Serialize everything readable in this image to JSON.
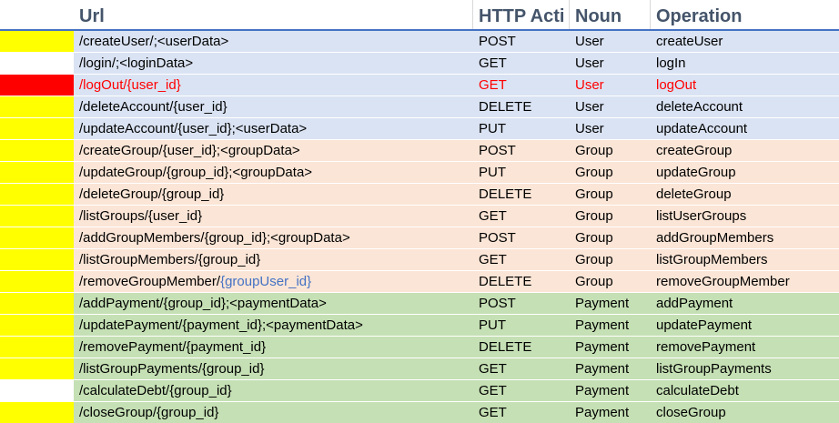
{
  "headers": {
    "url": "Url",
    "method": "HTTP Acti",
    "noun": "Noun",
    "operation": "Operation"
  },
  "colors": {
    "user_group": "#dae3f3",
    "group_group": "#fbe5d6",
    "payment_group": "#c5e0b4",
    "marker_yellow": "#ffff00",
    "marker_red": "#ff0000",
    "marker_white": "#ffffff",
    "highlight_text_red": "#ff0000",
    "highlight_text_blue": "#4472c4"
  },
  "rows": [
    {
      "url": "/createUser/;<userData>",
      "method": "POST",
      "noun": "User",
      "operation": "createUser",
      "marker": "yellow",
      "group": "user"
    },
    {
      "url": "/login/;<loginData>",
      "method": "GET",
      "noun": "User",
      "operation": "logIn",
      "marker": "white",
      "group": "user"
    },
    {
      "url": "/logOut/{user_id}",
      "method": "GET",
      "noun": "User",
      "operation": "logOut",
      "marker": "red",
      "group": "user",
      "red_text": true
    },
    {
      "url": "/deleteAccount/{user_id}",
      "method": "DELETE",
      "noun": "User",
      "operation": "deleteAccount",
      "marker": "yellow",
      "group": "user"
    },
    {
      "url": "/updateAccount/{user_id};<userData>",
      "method": "PUT",
      "noun": "User",
      "operation": "updateAccount",
      "marker": "yellow",
      "group": "user"
    },
    {
      "url": "/createGroup/{user_id};<groupData>",
      "method": "POST",
      "noun": "Group",
      "operation": "createGroup",
      "marker": "yellow",
      "group": "group"
    },
    {
      "url": "/updateGroup/{group_id};<groupData>",
      "method": "PUT",
      "noun": "Group",
      "operation": "updateGroup",
      "marker": "yellow",
      "group": "group"
    },
    {
      "url": "/deleteGroup/{group_id}",
      "method": "DELETE",
      "noun": "Group",
      "operation": "deleteGroup",
      "marker": "yellow",
      "group": "group"
    },
    {
      "url": "/listGroups/{user_id}",
      "method": "GET",
      "noun": "Group",
      "operation": "listUserGroups",
      "marker": "yellow",
      "group": "group"
    },
    {
      "url": "/addGroupMembers/{group_id};<groupData>",
      "method": "POST",
      "noun": "Group",
      "operation": "addGroupMembers",
      "marker": "yellow",
      "group": "group"
    },
    {
      "url": "/listGroupMembers/{group_id}",
      "method": "GET",
      "noun": "Group",
      "operation": "listGroupMembers",
      "marker": "yellow",
      "group": "group"
    },
    {
      "url": "/removeGroupMember/",
      "url_suffix": "{groupUser_id}",
      "method": "DELETE",
      "noun": "Group",
      "operation": "removeGroupMember",
      "marker": "yellow",
      "group": "group"
    },
    {
      "url": "/addPayment/{group_id};<paymentData>",
      "method": "POST",
      "noun": "Payment",
      "operation": "addPayment",
      "marker": "yellow",
      "group": "payment"
    },
    {
      "url": "/updatePayment/{payment_id};<paymentData>",
      "method": "PUT",
      "noun": "Payment",
      "operation": "updatePayment",
      "marker": "yellow",
      "group": "payment"
    },
    {
      "url": "/removePayment/{payment_id}",
      "method": "DELETE",
      "noun": "Payment",
      "operation": "removePayment",
      "marker": "yellow",
      "group": "payment"
    },
    {
      "url": "/listGroupPayments/{group_id}",
      "method": "GET",
      "noun": "Payment",
      "operation": "listGroupPayments",
      "marker": "yellow",
      "group": "payment"
    },
    {
      "url": "/calculateDebt/{group_id}",
      "method": "GET",
      "noun": "Payment",
      "operation": "calculateDebt",
      "marker": "white",
      "group": "payment"
    },
    {
      "url": "/closeGroup/{group_id}",
      "method": "GET",
      "noun": "Payment",
      "operation": "closeGroup",
      "marker": "yellow",
      "group": "payment"
    }
  ]
}
